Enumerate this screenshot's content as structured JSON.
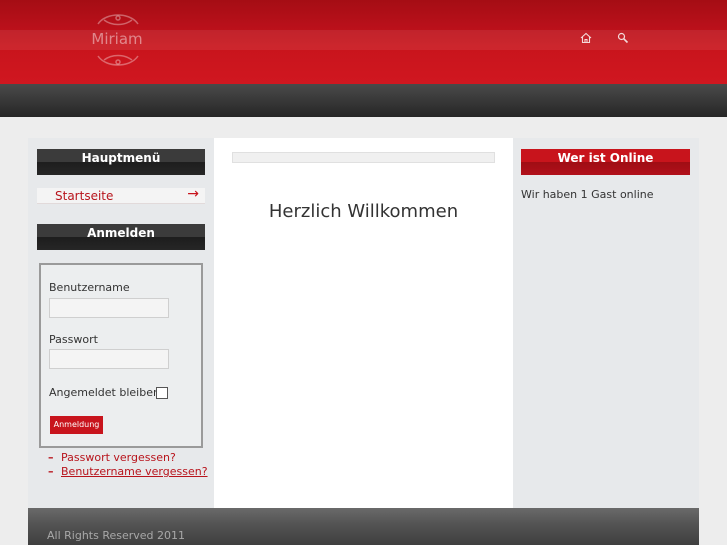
{
  "header": {
    "logo_text": "Miriam",
    "icons": [
      "home-icon",
      "search-icon"
    ]
  },
  "left": {
    "main_menu_title": "Hauptmenü",
    "menu_items": [
      {
        "label": "Startseite",
        "arrow": "→"
      }
    ],
    "login_title": "Anmelden",
    "username_label": "Benutzername",
    "password_label": "Passwort",
    "remember_label": "Angemeldet bleiben",
    "login_button": "Anmeldung",
    "forgot_password": "Passwort vergessen?",
    "forgot_username": "Benutzername vergessen?"
  },
  "center": {
    "welcome": "Herzlich Willkommen"
  },
  "right": {
    "online_title": "Wer ist Online",
    "online_text": "Wir haben 1 Gast online"
  },
  "footer": {
    "copyright": "All Rights Reserved 2011"
  },
  "colors": {
    "accent": "#c8141c",
    "dark": "#262626"
  }
}
